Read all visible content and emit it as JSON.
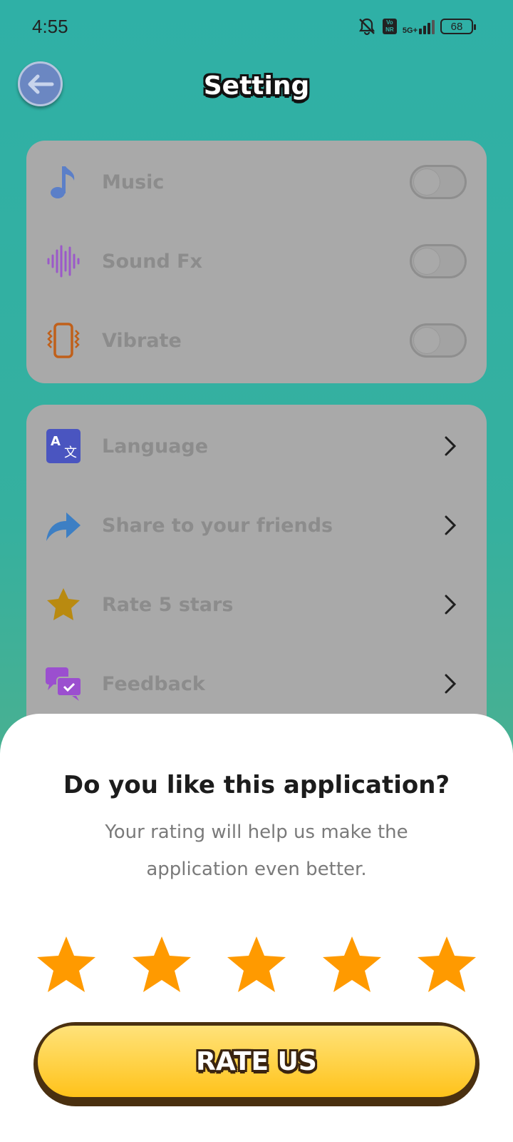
{
  "status_bar": {
    "time": "4:55",
    "network": "5G+",
    "volte": "Vo NR",
    "battery": "68"
  },
  "header": {
    "title": "Setting"
  },
  "toggles": [
    {
      "label": "Music",
      "icon": "music-note-icon",
      "on": false,
      "icon_color": "#5b7fc8"
    },
    {
      "label": "Sound Fx",
      "icon": "sound-wave-icon",
      "on": false,
      "icon_color": "#9b59c9"
    },
    {
      "label": "Vibrate",
      "icon": "vibrate-phone-icon",
      "on": false,
      "icon_color": "#c0601a"
    }
  ],
  "links": [
    {
      "label": "Language",
      "icon": "language-icon",
      "icon_color": "#4a55c0"
    },
    {
      "label": "Share to your friends",
      "icon": "share-arrow-icon",
      "icon_color": "#3d7fc4"
    },
    {
      "label": "Rate 5 stars",
      "icon": "star-icon",
      "icon_color": "#b98a10"
    },
    {
      "label": "Feedback",
      "icon": "chat-bubbles-icon",
      "icon_color": "#9b4fcf"
    }
  ],
  "rating_sheet": {
    "title": "Do you like this application?",
    "description": "Your rating will help us make the application even better.",
    "stars_selected": 5,
    "stars_total": 5,
    "star_color": "#ff9a00",
    "button_label": "RATE US"
  }
}
